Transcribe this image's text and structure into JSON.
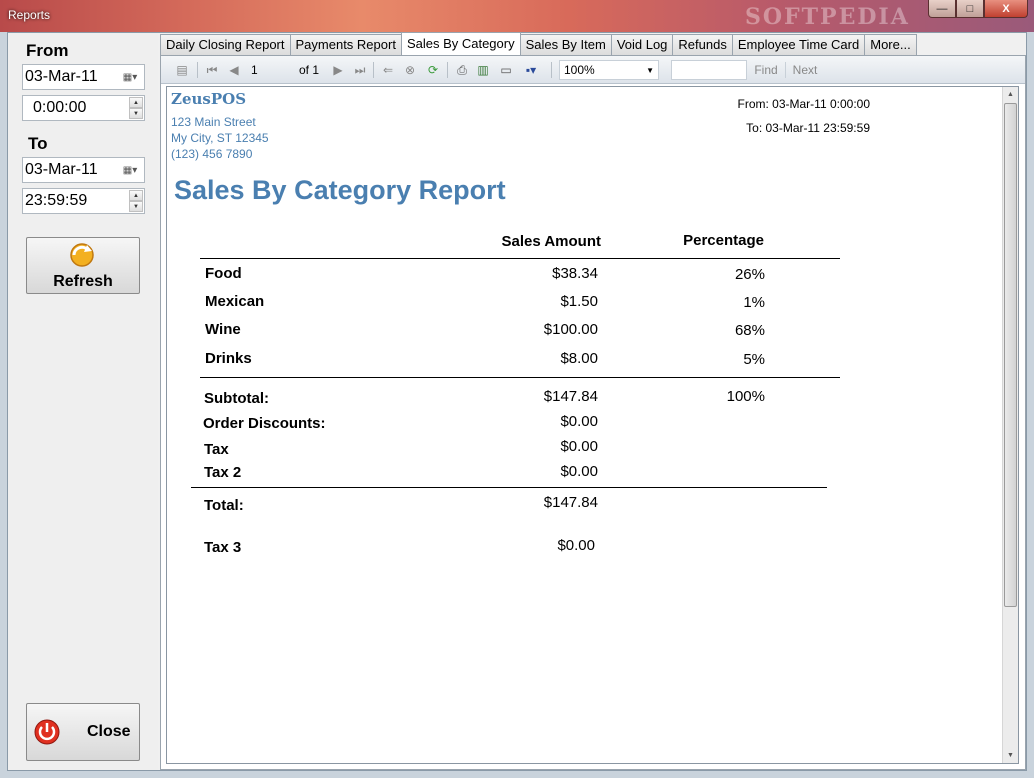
{
  "window": {
    "title": "Reports",
    "watermark": "SOFTPEDIA",
    "buttons": {
      "minimize": "—",
      "maximize": "□",
      "close": "X"
    }
  },
  "left_panel": {
    "from_label": "From",
    "from_date": "03-Mar-11",
    "from_time": "0:00:00",
    "to_label": "To",
    "to_date": "03-Mar-11",
    "to_time": "23:59:59",
    "refresh_label": "Refresh",
    "close_label": "Close"
  },
  "tabs": [
    {
      "label": "Daily Closing Report"
    },
    {
      "label": "Payments Report"
    },
    {
      "label": "Sales By Category"
    },
    {
      "label": "Sales By Item"
    },
    {
      "label": "Void Log"
    },
    {
      "label": "Refunds"
    },
    {
      "label": "Employee Time Card"
    },
    {
      "label": "More..."
    }
  ],
  "toolbar": {
    "page": "1",
    "of_pages": "of 1",
    "zoom": "100%",
    "find_value": "",
    "find_label": "Find",
    "next_label": "Next"
  },
  "report": {
    "company": "ZeusPOS",
    "address1": "123 Main Street",
    "address2": "My City, ST 12345",
    "phone": "(123) 456 7890",
    "from_text": "From: 03-Mar-11 0:00:00",
    "to_text": "To: 03-Mar-11 23:59:59",
    "title": "Sales By Category Report",
    "col_sales": "Sales Amount",
    "col_pct": "Percentage",
    "rows": [
      {
        "name": "Food",
        "amount": "$38.34",
        "pct": "26%"
      },
      {
        "name": "Mexican",
        "amount": "$1.50",
        "pct": "1%"
      },
      {
        "name": "Wine",
        "amount": "$100.00",
        "pct": "68%"
      },
      {
        "name": "Drinks",
        "amount": "$8.00",
        "pct": "5%"
      }
    ],
    "subtotal_label": "Subtotal:",
    "subtotal_amount": "$147.84",
    "subtotal_pct": "100%",
    "order_discounts_label": "Order Discounts:",
    "order_discounts_amount": "$0.00",
    "tax_label": "Tax",
    "tax_amount": "$0.00",
    "tax2_label": "Tax 2",
    "tax2_amount": "$0.00",
    "total_label": "Total:",
    "total_amount": "$147.84",
    "tax3_label": "Tax 3",
    "tax3_amount": "$0.00"
  }
}
